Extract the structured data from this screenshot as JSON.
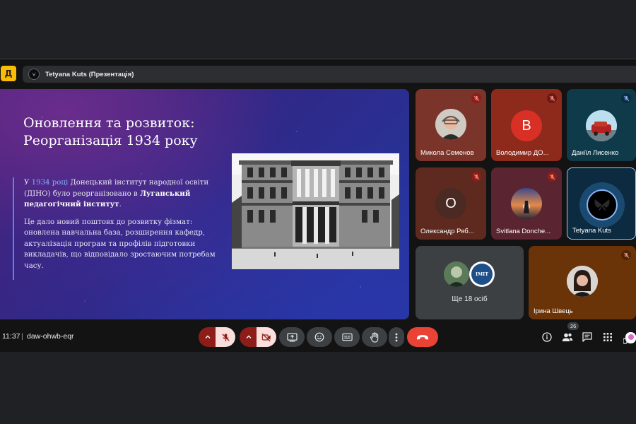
{
  "topbar": {
    "presenter_label": "Tetyana Kuts (Презентація)"
  },
  "slide": {
    "title_line1": "Оновлення та розвиток:",
    "title_line2": "Реорганізація 1934 року",
    "p1_a": "У ",
    "p1_year": "1934 році",
    "p1_b": " Донецький інститут народної освіти (ДІНО) було реорганізовано в ",
    "p1_bold": "Луганський педагогічний інститут",
    "p1_c": ".",
    "p2": "Це дало новий поштовх до розвитку фізмат: оновлена навчальна база, розширення кафедр, актуалізація програм та профілів підготовки викладачів, що відповідало зростаючим потребам часу."
  },
  "participants": [
    {
      "name": "Микола Семенов",
      "muted": true
    },
    {
      "name": "Володимир ДО...",
      "initial": "В",
      "muted": true
    },
    {
      "name": "Даніїл Лисенко",
      "muted": true
    },
    {
      "name": "Олександр Ряб...",
      "initial": "О",
      "muted": true
    },
    {
      "name": "Svitlana Donche...",
      "muted": true
    },
    {
      "name": "Tetyana Kuts",
      "muted": false
    },
    {
      "name": "Ще 18 осіб",
      "badge_text": "IMIT"
    },
    {
      "name": "Ірина Швець",
      "muted": true
    }
  ],
  "bottombar": {
    "time": "11:37",
    "separator": "|",
    "meeting_code": "daw-ohwb-eqr",
    "people_count": "26"
  },
  "colors": {
    "accent_blue": "#4a90e2",
    "end_call_red": "#ea4335",
    "muted_red": "#8c1d18",
    "background": "#131314"
  }
}
